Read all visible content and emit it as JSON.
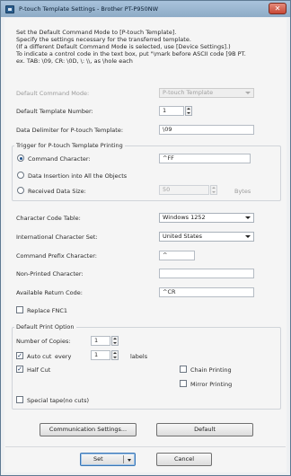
{
  "window": {
    "title": "P-touch Template Settings - Brother PT-P950NW",
    "close_glyph": "✕"
  },
  "intro": {
    "lines": [
      "Set the Default Command Mode to [P-touch Template].",
      "Specify the settings necessary for the transferred template.",
      "(If a different Default Command Mode is selected, use [Device Settings].)",
      "To indicate a control code in the text box, put \"\\mark before ASCII code [9B PT.",
      "ex. TAB: \\09, CR: \\0D, \\: \\\\, as \\hole each"
    ]
  },
  "settings": {
    "default_command_mode_label": "Default Command Mode:",
    "default_command_mode_value": "P-touch Template",
    "default_template_number_label": "Default Template Number:",
    "default_template_number_value": "1",
    "data_delimiter_label": "Data Delimiter for P-touch Template:",
    "data_delimiter_value": "\\09"
  },
  "trigger": {
    "group_title": "Trigger for P-touch Template Printing",
    "command_character_label": "Command Character:",
    "command_character_value": "^FF",
    "data_insertion_label": "Data Insertion into All the Objects",
    "received_data_size_label": "Received Data Size:",
    "received_data_size_value": "50",
    "received_data_size_unit": "Bytes",
    "selected": "command_character"
  },
  "codes": {
    "character_code_table_label": "Character Code Table:",
    "character_code_table_value": "Windows 1252",
    "international_character_set_label": "International Character Set:",
    "international_character_set_value": "United States",
    "command_prefix_label": "Command Prefix Character:",
    "command_prefix_value": "^",
    "non_printed_character_label": "Non-Printed Character:",
    "non_printed_character_value": "",
    "available_return_code_label": "Available Return Code:",
    "available_return_code_value": "^CR",
    "replace_fnc1_label": "Replace FNC1"
  },
  "print_option": {
    "group_title": "Default Print Option",
    "number_of_copies_label": "Number of Copies:",
    "number_of_copies_value": "1",
    "auto_cut_label": "Auto cut",
    "every_label": "every",
    "every_value": "1",
    "every_unit": "labels",
    "half_cut_label": "Half Cut",
    "chain_printing_label": "Chain Printing",
    "mirror_printing_label": "Mirror Printing",
    "special_tape_label": "Special tape(no cuts)",
    "check_glyph": "✓"
  },
  "buttons": {
    "communication_settings": "Communication Settings...",
    "default": "Default",
    "set": "Set",
    "cancel": "Cancel"
  }
}
